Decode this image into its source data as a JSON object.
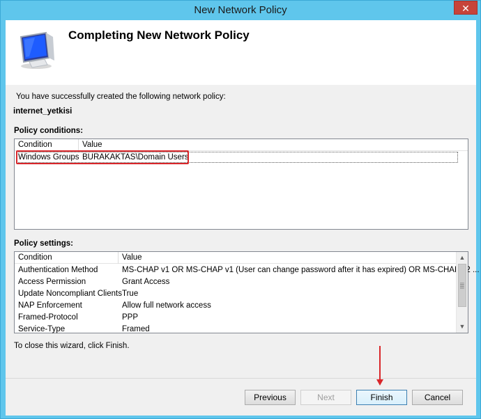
{
  "window": {
    "title": "New Network Policy",
    "close_glyph": "✕"
  },
  "header": {
    "title": "Completing New Network Policy",
    "icon": "monitor-icon"
  },
  "intro_text": "You have successfully created the following network policy:",
  "policy_name": "internet_yetkisi",
  "conditions": {
    "label": "Policy conditions:",
    "columns": [
      "Condition",
      "Value"
    ],
    "rows": [
      {
        "condition": "Windows Groups",
        "value": "BURAKAKTAS\\Domain Users"
      }
    ]
  },
  "settings": {
    "label": "Policy settings:",
    "columns": [
      "Condition",
      "Value"
    ],
    "rows": [
      {
        "condition": "Authentication Method",
        "value": "MS-CHAP v1 OR MS-CHAP v1 (User can change password after it has expired) OR MS-CHAP v2 ..."
      },
      {
        "condition": "Access Permission",
        "value": "Grant Access"
      },
      {
        "condition": "Update Noncompliant Clients",
        "value": "True"
      },
      {
        "condition": "NAP Enforcement",
        "value": "Allow full network access"
      },
      {
        "condition": "Framed-Protocol",
        "value": "PPP"
      },
      {
        "condition": "Service-Type",
        "value": "Framed"
      }
    ]
  },
  "close_hint": "To close this wizard, click Finish.",
  "buttons": {
    "previous": "Previous",
    "next": "Next",
    "finish": "Finish",
    "cancel": "Cancel"
  },
  "colors": {
    "titlebar": "#5fc6ec",
    "annotation_red": "#d9262a",
    "close_button": "#c7443a"
  }
}
